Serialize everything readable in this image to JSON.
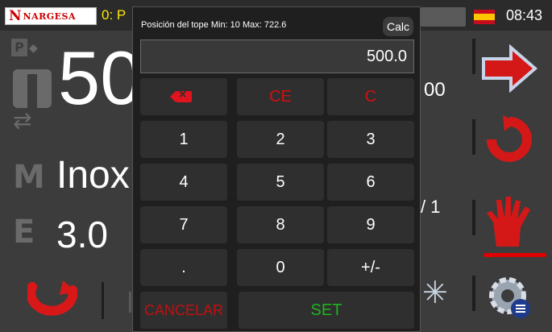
{
  "header": {
    "logo_text": "NARGESA",
    "program": "0: P",
    "clock": "08:43",
    "language": "es"
  },
  "background": {
    "position_partial": "50",
    "material_partial": "Inox",
    "thickness": "3.0",
    "right_value_partial": "00",
    "right_ratio_partial": "/ 1"
  },
  "modal": {
    "title": "Posición del tope Min: 10 Max: 722.6",
    "calc_label": "Calc",
    "display_value": "500.0",
    "keys": {
      "ce": "CE",
      "c": "C",
      "k1": "1",
      "k2": "2",
      "k3": "3",
      "k4": "4",
      "k5": "5",
      "k6": "6",
      "k7": "7",
      "k8": "8",
      "k9": "9",
      "dot": ".",
      "k0": "0",
      "sign": "+/-",
      "cancel": "CANCELAR",
      "set": "SET"
    }
  },
  "colors": {
    "accent_red": "#d01010",
    "set_green": "#1fb21f",
    "program_yellow": "#ffe600"
  },
  "icons": [
    "backspace-icon",
    "next-arrow-icon",
    "cycle-icon",
    "hand-stop-icon",
    "settings-gear-icon",
    "undo-arrow-icon",
    "burst-icon"
  ]
}
